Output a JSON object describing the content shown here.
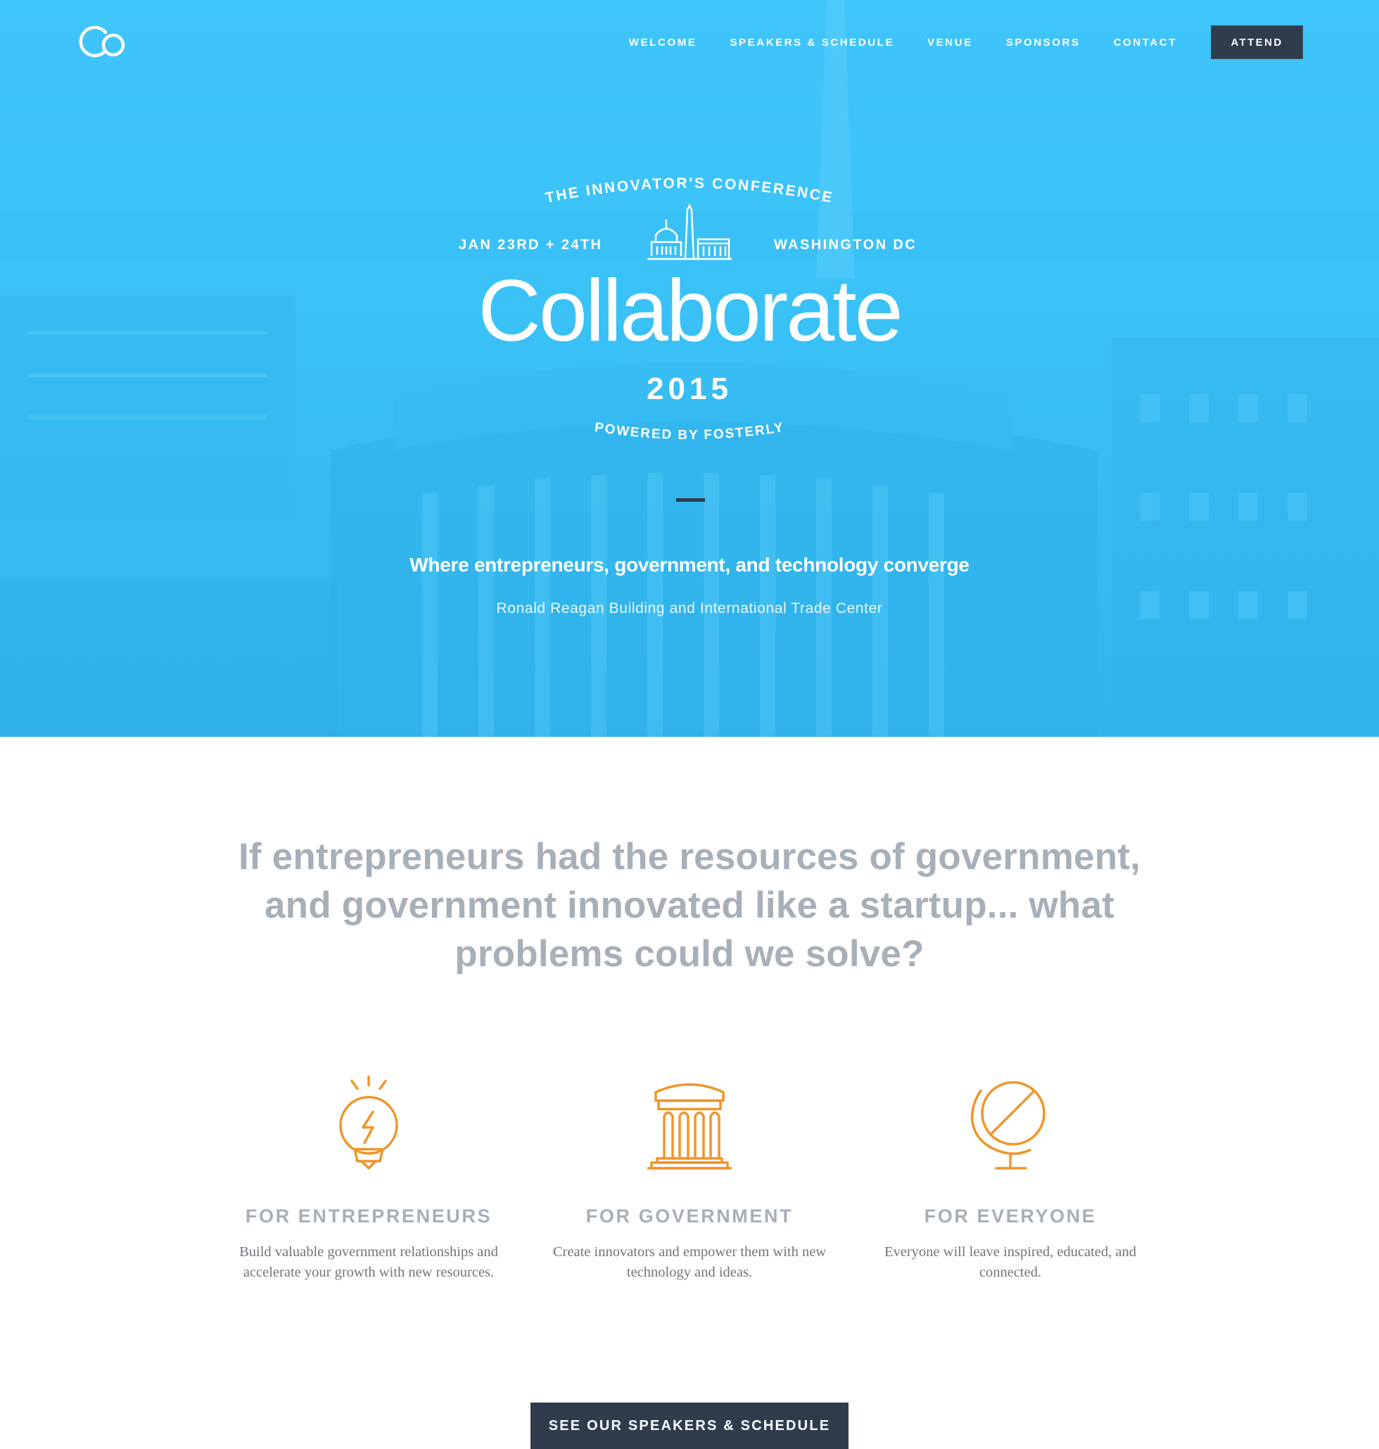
{
  "nav": {
    "logo_alt": "Co",
    "items": [
      {
        "label": "WELCOME"
      },
      {
        "label": "SPEAKERS & SCHEDULE"
      },
      {
        "label": "VENUE"
      },
      {
        "label": "SPONSORS"
      },
      {
        "label": "CONTACT"
      }
    ],
    "attend_label": "ATTEND"
  },
  "hero": {
    "arc_top": "THE INNOVATOR'S CONFERENCE",
    "date": "JAN 23RD + 24TH",
    "location": "WASHINGTON DC",
    "title": "Collaborate",
    "year": "2015",
    "arc_bottom": "POWERED BY FOSTERLY",
    "tagline": "Where entrepreneurs, government, and technology converge",
    "venue": "Ronald Reagan Building and International Trade Center"
  },
  "intro": {
    "headline": "If entrepreneurs had the resources of government, and government innovated like a startup... what problems could we solve?"
  },
  "features": [
    {
      "icon": "lightbulb-icon",
      "title": "FOR ENTREPRENEURS",
      "desc": "Build valuable government relationships and  accelerate your growth with new resources."
    },
    {
      "icon": "government-building-icon",
      "title": "FOR GOVERNMENT",
      "desc": "Create innovators and empower them with new technology and ideas."
    },
    {
      "icon": "globe-icon",
      "title": "FOR EVERYONE",
      "desc": "Everyone will leave inspired, educated, and connected."
    }
  ],
  "cta": {
    "label": "SEE OUR SPEAKERS & SCHEDULE"
  },
  "colors": {
    "hero_blue": "#3ec5fb",
    "dark_navy": "#2e3c4c",
    "accent_orange": "#f0952a",
    "headline_gray": "#a7afb8"
  }
}
